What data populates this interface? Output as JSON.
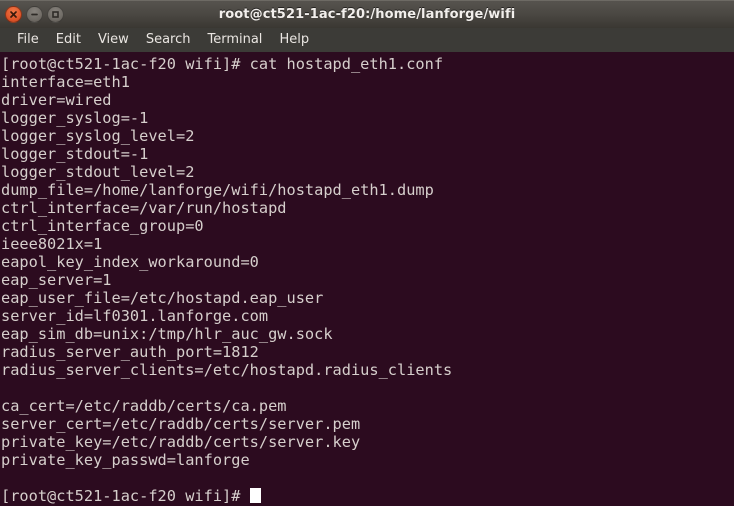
{
  "window": {
    "title": "root@ct521-1ac-f20:/home/lanforge/wifi",
    "buttons": {
      "close": "close-button",
      "minimize": "minimize-button",
      "maximize": "maximize-button"
    },
    "colors": {
      "titlebar_top": "#56534e",
      "titlebar_bottom": "#3a3732",
      "menubar_bg": "#3c3b37",
      "terminal_bg": "#2c0b1f",
      "terminal_fg": "#d6cfcc",
      "close_button": "#e0562a",
      "cursor": "#ffffff",
      "desktop_accent": "#c9622f"
    }
  },
  "menubar": {
    "items": [
      {
        "label": "File"
      },
      {
        "label": "Edit"
      },
      {
        "label": "View"
      },
      {
        "label": "Search"
      },
      {
        "label": "Terminal"
      },
      {
        "label": "Help"
      }
    ]
  },
  "terminal": {
    "prompt": "[root@ct521-1ac-f20 wifi]#",
    "command": "cat hostapd_eth1.conf",
    "lines": [
      "[root@ct521-1ac-f20 wifi]# cat hostapd_eth1.conf",
      "interface=eth1",
      "driver=wired",
      "logger_syslog=-1",
      "logger_syslog_level=2",
      "logger_stdout=-1",
      "logger_stdout_level=2",
      "dump_file=/home/lanforge/wifi/hostapd_eth1.dump",
      "ctrl_interface=/var/run/hostapd",
      "ctrl_interface_group=0",
      "ieee8021x=1",
      "eapol_key_index_workaround=0",
      "eap_server=1",
      "eap_user_file=/etc/hostapd.eap_user",
      "server_id=lf0301.lanforge.com",
      "eap_sim_db=unix:/tmp/hlr_auc_gw.sock",
      "radius_server_auth_port=1812",
      "radius_server_clients=/etc/hostapd.radius_clients",
      "",
      "ca_cert=/etc/raddb/certs/ca.pem",
      "server_cert=/etc/raddb/certs/server.pem",
      "private_key=/etc/raddb/certs/server.key",
      "private_key_passwd=lanforge",
      ""
    ],
    "final_prompt": "[root@ct521-1ac-f20 wifi]# "
  }
}
